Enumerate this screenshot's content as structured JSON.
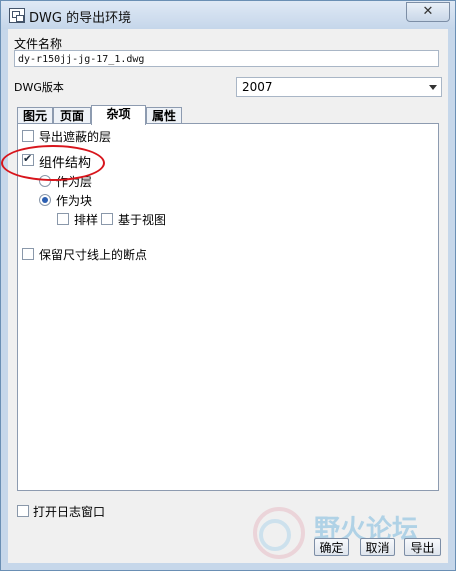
{
  "window": {
    "title": "DWG 的导出环境",
    "close_label": "✕"
  },
  "file": {
    "label": "文件名称",
    "value": "dy-r150jj-jg-17_1.dwg"
  },
  "version": {
    "label": "DWG版本",
    "selected": "2007"
  },
  "tabs": [
    {
      "label": "图元",
      "active": false
    },
    {
      "label": "页面",
      "active": false
    },
    {
      "label": "杂项",
      "active": true
    },
    {
      "label": "属性",
      "active": false
    }
  ],
  "misc": {
    "export_hidden_layers": {
      "label": "导出遮蔽的层",
      "checked": false
    },
    "component_structure": {
      "label": "组件结构",
      "checked": true
    },
    "as_layer": {
      "label": "作为层",
      "selected": false
    },
    "as_block": {
      "label": "作为块",
      "selected": true
    },
    "sort": {
      "label": "排样",
      "checked": false
    },
    "view_based": {
      "label": "基于视图",
      "checked": false
    },
    "keep_dim_breaks": {
      "label": "保留尺寸线上的断点",
      "checked": false
    }
  },
  "log": {
    "label": "打开日志窗口",
    "checked": false
  },
  "buttons": {
    "ok": "确定",
    "cancel": "取消",
    "export": "导出"
  },
  "watermark": {
    "text": "野火论坛"
  },
  "colors": {
    "annotation": "#d8151c",
    "frame": "#c6d7ea"
  }
}
